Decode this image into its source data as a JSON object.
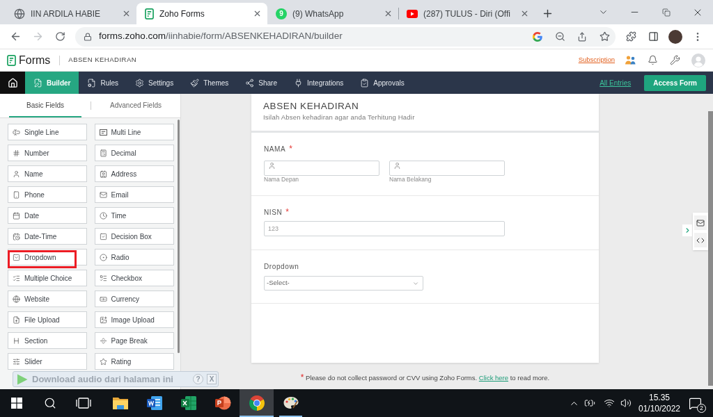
{
  "browser": {
    "tabs": [
      {
        "title": "IIN ARDILA HABIE",
        "selected": false
      },
      {
        "title": "Zoho Forms",
        "selected": true
      },
      {
        "title": "(9) WhatsApp",
        "badge": "9",
        "selected": false
      },
      {
        "title": "(287) TULUS - Diri (Offi",
        "selected": false
      }
    ],
    "forward_disabled": true,
    "url_host": "forms.zoho.com",
    "url_path": "/iinhabie/form/ABSENKEHADIRAN/builder"
  },
  "app_header": {
    "app_name": "Forms",
    "form_name": "ABSEN KEHADIRAN",
    "subscription": "Subscription"
  },
  "nav": {
    "items": [
      {
        "label": "Builder",
        "selected": true
      },
      {
        "label": "Rules",
        "selected": false
      },
      {
        "label": "Settings",
        "selected": false
      },
      {
        "label": "Themes",
        "selected": false
      },
      {
        "label": "Share",
        "selected": false
      },
      {
        "label": "Integrations",
        "selected": false
      },
      {
        "label": "Approvals",
        "selected": false
      }
    ],
    "all_entries": "All Entries",
    "access_form": "Access Form"
  },
  "fields_panel": {
    "tabs": [
      {
        "label": "Basic Fields",
        "selected": true
      },
      {
        "label": "Advanced Fields",
        "selected": false
      }
    ],
    "fields": [
      {
        "label": "Single Line",
        "highlighted": false
      },
      {
        "label": "Multi Line",
        "highlighted": false
      },
      {
        "label": "Number",
        "highlighted": false
      },
      {
        "label": "Decimal",
        "highlighted": false
      },
      {
        "label": "Name",
        "highlighted": false
      },
      {
        "label": "Address",
        "highlighted": false
      },
      {
        "label": "Phone",
        "highlighted": false
      },
      {
        "label": "Email",
        "highlighted": false
      },
      {
        "label": "Date",
        "highlighted": false
      },
      {
        "label": "Time",
        "highlighted": false
      },
      {
        "label": "Date-Time",
        "highlighted": false
      },
      {
        "label": "Decision Box",
        "highlighted": false
      },
      {
        "label": "Dropdown",
        "highlighted": true
      },
      {
        "label": "Radio",
        "highlighted": false
      },
      {
        "label": "Multiple Choice",
        "highlighted": false
      },
      {
        "label": "Checkbox",
        "highlighted": false
      },
      {
        "label": "Website",
        "highlighted": false
      },
      {
        "label": "Currency",
        "highlighted": false
      },
      {
        "label": "File Upload",
        "highlighted": false
      },
      {
        "label": "Image Upload",
        "highlighted": false
      },
      {
        "label": "Section",
        "highlighted": false
      },
      {
        "label": "Page Break",
        "highlighted": false
      },
      {
        "label": "Slider",
        "highlighted": false
      },
      {
        "label": "Rating",
        "highlighted": false
      }
    ]
  },
  "form": {
    "title": "ABSEN KEHADIRAN",
    "description": "Isilah Absen kehadiran agar anda Terhitung Hadir",
    "fields": [
      {
        "kind": "name",
        "label": "NAMA",
        "required_mark": "*",
        "parts": [
          {
            "sublabel": "Nama Depan"
          },
          {
            "sublabel": "Nama Belakang"
          }
        ]
      },
      {
        "kind": "number",
        "label": "NISN",
        "required_mark": "*",
        "placeholder": "123"
      },
      {
        "kind": "dropdown",
        "label": "Dropdown",
        "placeholder": "-Select-"
      }
    ]
  },
  "notice": {
    "mark": "*",
    "text": "Please do not collect password or CVV using Zoho Forms.",
    "link": "Click here",
    "after": "to read more."
  },
  "audio_bar": {
    "label": "Download audio dari halaman ini",
    "help": "?",
    "close": "X"
  },
  "taskbar": {
    "apps": [
      {
        "selected": false,
        "open": false
      },
      {
        "selected": false,
        "open": false
      },
      {
        "selected": false,
        "open": false
      },
      {
        "selected": false,
        "open": false
      },
      {
        "selected": true,
        "open": true
      },
      {
        "selected": false,
        "open": true
      }
    ],
    "time": "15.35",
    "date": "01/10/2022",
    "notifications": "2"
  }
}
